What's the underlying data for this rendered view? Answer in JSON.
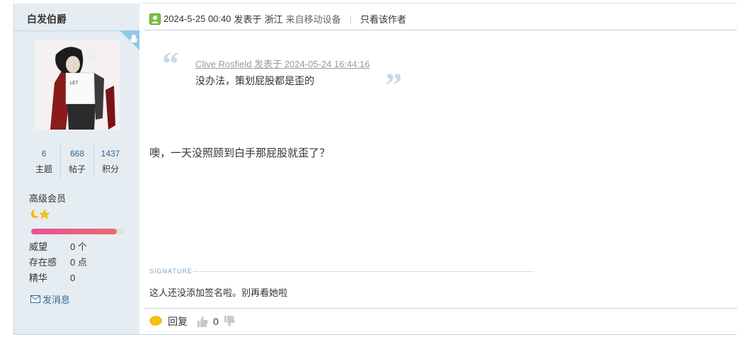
{
  "author": {
    "name": "白发伯爵",
    "stats": [
      {
        "value": "6",
        "label": "主题"
      },
      {
        "value": "668",
        "label": "帖子"
      },
      {
        "value": "1437",
        "label": "积分"
      }
    ],
    "group": "高级会员",
    "credit_progress": 0.92,
    "info": [
      {
        "label": "威望",
        "value": "0 个"
      },
      {
        "label": "存在感",
        "value": "0 点"
      },
      {
        "label": "精华",
        "value": "0"
      }
    ],
    "send_message": "发消息"
  },
  "post": {
    "posted_at": "2024-5-25 00:40",
    "posted_prefix": "发表于",
    "location": "浙江",
    "source": "来自移动设备",
    "only_author": "只看该作者",
    "quote": {
      "author_line": "Clive Rosfield 发表于 2024-05-24 16:44:16",
      "text": "没办法，策划屁股都是歪的"
    },
    "body": "噢，一天没照顾到白手那屁股就歪了？",
    "signature_label": "SIGNATURE",
    "signature": "这人还没添加签名啦。别再看她啦",
    "actions": {
      "reply": "回复",
      "like_count": "0"
    }
  },
  "colors": {
    "sidebar_bg": "#e5edf2",
    "link": "#336699",
    "border": "#c2d5e3"
  }
}
